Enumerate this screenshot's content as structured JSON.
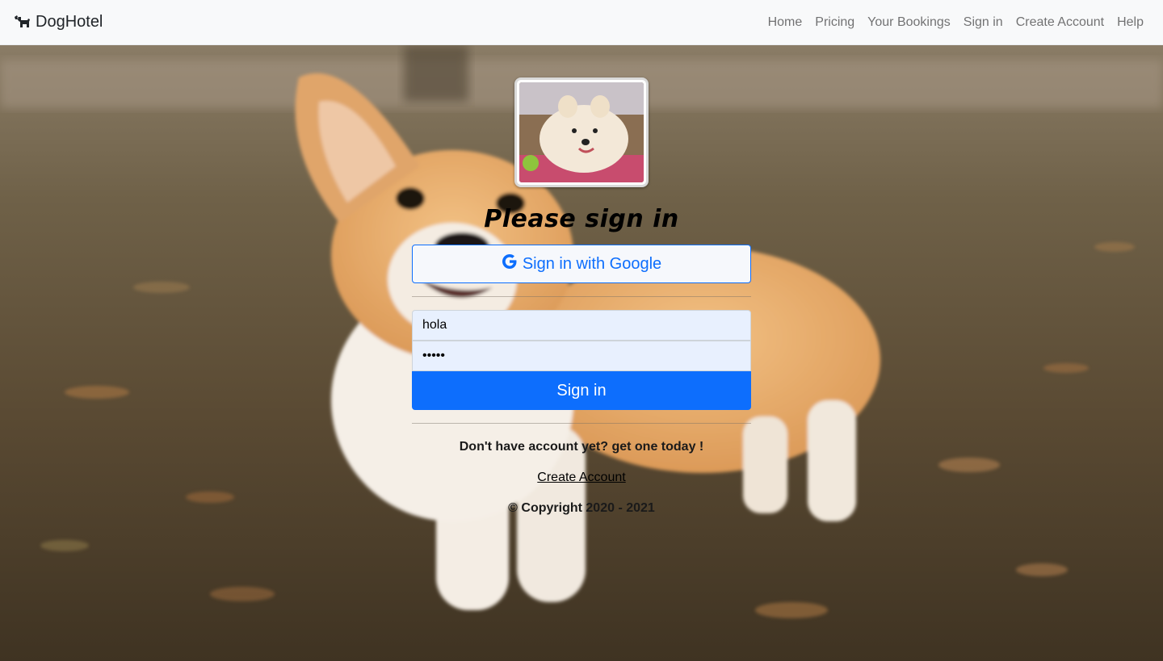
{
  "navbar": {
    "brand": "DogHotel",
    "brand_icon": "dog-icon",
    "links": [
      "Home",
      "Pricing",
      "Your Bookings",
      "Sign in",
      "Create Account",
      "Help"
    ]
  },
  "form": {
    "title": "Please sign in",
    "google_button": "Sign in with Google",
    "google_icon": "google-icon",
    "username_value": "hola",
    "password_value": "hola1",
    "signin_button": "Sign in",
    "prompt": "Don't have account yet? get one today !",
    "create_link": "Create Account",
    "copyright": "© Copyright 2020 - 2021"
  },
  "colors": {
    "primary": "#0d6efd",
    "navbar_bg": "#f8f9fa",
    "input_bg": "#e8f0fe"
  }
}
